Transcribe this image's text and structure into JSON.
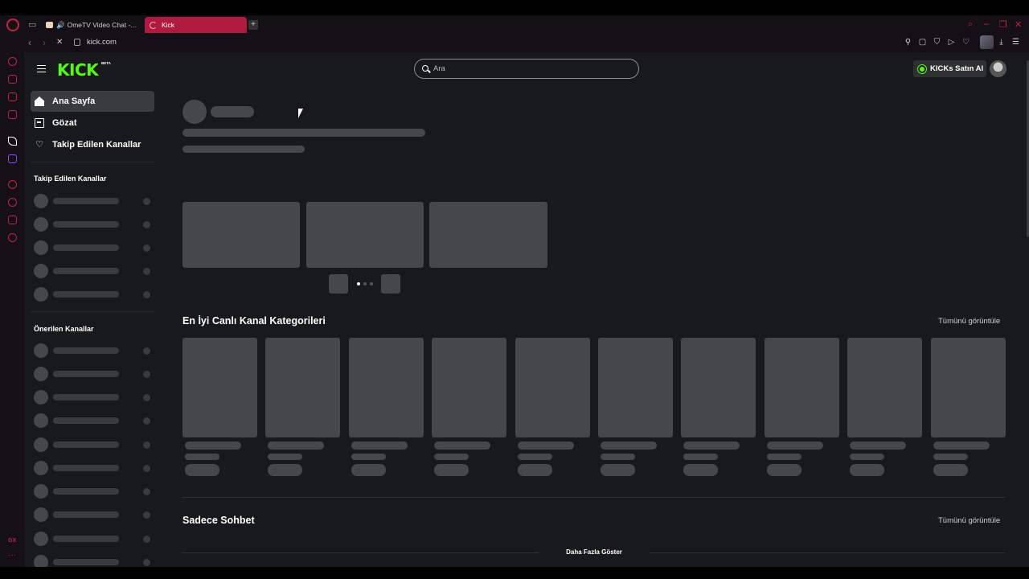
{
  "browser": {
    "tabs": [
      {
        "title": "OmeTV Video Chat -..."
      },
      {
        "title": "Kick"
      }
    ],
    "new_tab_label": "+",
    "url": "kick.com"
  },
  "header": {
    "logo": "KICK",
    "logo_badge": "BETA",
    "search_placeholder": "Ara",
    "kicks_button": "KICKs Satın Al"
  },
  "sidebar": {
    "nav": [
      {
        "label": "Ana Sayfa",
        "icon": "home-icon"
      },
      {
        "label": "Gözat",
        "icon": "browse-icon"
      },
      {
        "label": "Takip Edilen Kanallar",
        "icon": "heart-icon"
      }
    ],
    "followed_title": "Takip Edilen Kanallar",
    "recommended_title": "Önerilen Kanallar"
  },
  "main": {
    "categories_title": "En İyi Canlı Kanal Kategorileri",
    "categories_see_all": "Tümünü görüntüle",
    "chat_title": "Sadece Sohbet",
    "chat_see_all": "Tümünü görüntüle",
    "show_more": "Daha Fazla Göster"
  },
  "opera_sidebar": {
    "gx_label": "GX",
    "more_label": "···"
  },
  "colors": {
    "kick_green": "#53fc18",
    "opera_red": "#c81f45",
    "page_bg": "#18191b",
    "skeleton": "#45474a"
  }
}
